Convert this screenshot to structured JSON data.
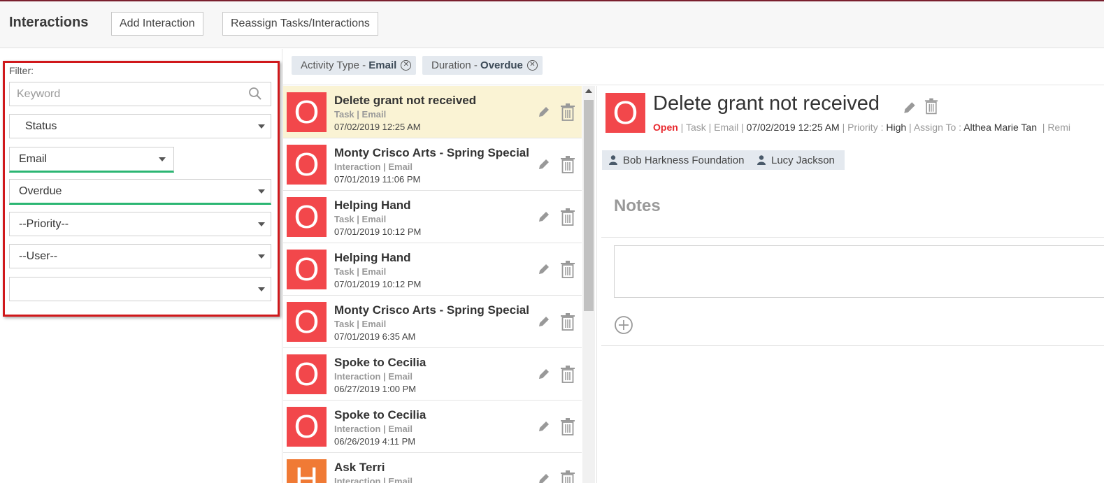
{
  "header": {
    "title": "Interactions",
    "add_button": "Add Interaction",
    "reassign_button": "Reassign Tasks/Interactions"
  },
  "filter": {
    "label": "Filter:",
    "keyword_placeholder": "Keyword",
    "status": "Status",
    "activity_type": "Email",
    "duration": "Overdue",
    "priority": "--Priority--",
    "user": "--User--",
    "extra": ""
  },
  "chips": [
    {
      "label": "Activity Type - ",
      "value": "Email"
    },
    {
      "label": "Duration - ",
      "value": "Overdue"
    }
  ],
  "list": [
    {
      "initial": "O",
      "title": "Delete grant not received",
      "meta": "Task | Email",
      "date": "07/02/2019 12:25 AM",
      "color": "#f2474b"
    },
    {
      "initial": "O",
      "title": "Monty Crisco Arts - Spring Special",
      "meta": "Interaction | Email",
      "date": "07/01/2019 11:06 PM",
      "color": "#f2474b"
    },
    {
      "initial": "O",
      "title": "Helping Hand",
      "meta": "Task | Email",
      "date": "07/01/2019 10:12 PM",
      "color": "#f2474b"
    },
    {
      "initial": "O",
      "title": "Helping Hand",
      "meta": "Task | Email",
      "date": "07/01/2019 10:12 PM",
      "color": "#f2474b"
    },
    {
      "initial": "O",
      "title": "Monty Crisco Arts - Spring Special",
      "meta": "Task | Email",
      "date": "07/01/2019 6:35 AM",
      "color": "#f2474b"
    },
    {
      "initial": "O",
      "title": "Spoke to Cecilia",
      "meta": "Interaction | Email",
      "date": "06/27/2019 1:00 PM",
      "color": "#f2474b"
    },
    {
      "initial": "O",
      "title": "Spoke to Cecilia",
      "meta": "Interaction | Email",
      "date": "06/26/2019 4:11 PM",
      "color": "#f2474b"
    },
    {
      "initial": "H",
      "title": "Ask Terri",
      "meta": "Interaction | Email",
      "date": "",
      "color": "#f07a35"
    }
  ],
  "detail": {
    "initial": "O",
    "title": "Delete grant not received",
    "status": "Open",
    "type": "Task",
    "activity": "Email",
    "date": "07/02/2019 12:25 AM",
    "priority_label": "Priority :",
    "priority": "High",
    "assign_label": "Assign To :",
    "assignee": "Althea Marie Tan",
    "reminder_label": "Remi",
    "tags": [
      "Bob Harkness Foundation",
      "Lucy Jackson"
    ],
    "notes_title": "Notes"
  }
}
